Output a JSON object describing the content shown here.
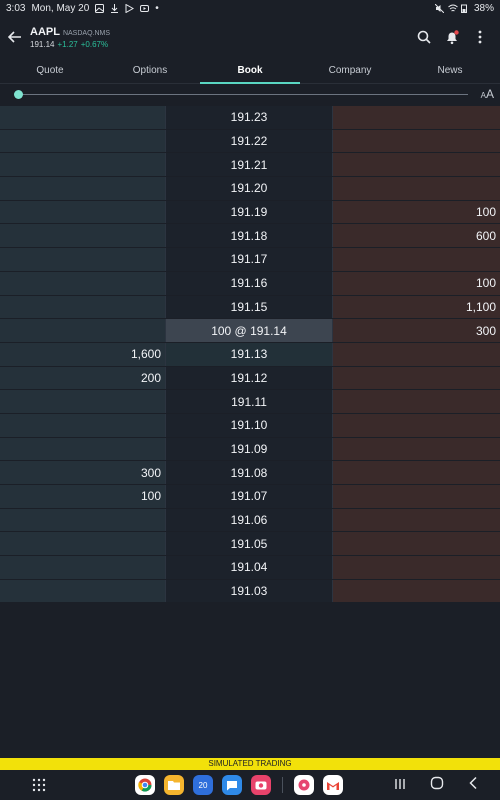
{
  "status": {
    "time": "3:03",
    "date": "Mon, May 20",
    "battery": "38%"
  },
  "header": {
    "symbol": "AAPL",
    "exchange": "NASDAQ.NMS",
    "price": "191.14",
    "change": "+1.27",
    "change_pct": "+0.67%"
  },
  "tabs": [
    "Quote",
    "Options",
    "Book",
    "Company",
    "News"
  ],
  "active_tab": "Book",
  "font_icon": {
    "large": "A",
    "small": "A"
  },
  "book": [
    {
      "bid": "",
      "price": "191.23",
      "ask": ""
    },
    {
      "bid": "",
      "price": "191.22",
      "ask": ""
    },
    {
      "bid": "",
      "price": "191.21",
      "ask": ""
    },
    {
      "bid": "",
      "price": "191.20",
      "ask": ""
    },
    {
      "bid": "",
      "price": "191.19",
      "ask": "100"
    },
    {
      "bid": "",
      "price": "191.18",
      "ask": "600"
    },
    {
      "bid": "",
      "price": "191.17",
      "ask": ""
    },
    {
      "bid": "",
      "price": "191.16",
      "ask": "100"
    },
    {
      "bid": "",
      "price": "191.15",
      "ask": "1,100"
    },
    {
      "bid": "",
      "price": "100 @ 191.14",
      "ask": "300"
    },
    {
      "bid": "1,600",
      "price": "191.13",
      "ask": ""
    },
    {
      "bid": "200",
      "price": "191.12",
      "ask": ""
    },
    {
      "bid": "",
      "price": "191.11",
      "ask": ""
    },
    {
      "bid": "",
      "price": "191.10",
      "ask": ""
    },
    {
      "bid": "",
      "price": "191.09",
      "ask": ""
    },
    {
      "bid": "300",
      "price": "191.08",
      "ask": ""
    },
    {
      "bid": "100",
      "price": "191.07",
      "ask": ""
    },
    {
      "bid": "",
      "price": "191.06",
      "ask": ""
    },
    {
      "bid": "",
      "price": "191.05",
      "ask": ""
    },
    {
      "bid": "",
      "price": "191.04",
      "ask": ""
    },
    {
      "bid": "",
      "price": "191.03",
      "ask": ""
    }
  ],
  "banner": "SIMULATED TRADING",
  "dock": {
    "calendar_day": "20"
  }
}
